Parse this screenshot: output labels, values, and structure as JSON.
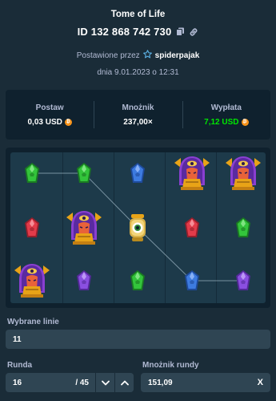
{
  "header": {
    "title": "Tome of Life",
    "bet_id": "ID 132 868 742 730",
    "placed_by_label": "Postawione przez",
    "username": "spiderpajak",
    "date": "dnia 9.01.2023 o 12:31"
  },
  "stats": {
    "bet_label": "Postaw",
    "bet_value": "0,03 USD",
    "multiplier_label": "Mnożnik",
    "multiplier_value": "237,00×",
    "payout_label": "Wypłata",
    "payout_value": "7,12 USD",
    "payout_color": "#00e701",
    "currency_icon": "bitcoin-coin-icon"
  },
  "board": {
    "columns": 5,
    "rows": 3,
    "grid": [
      [
        "green-gem",
        "green-gem",
        "blue-gem",
        "pharaoh",
        "pharaoh"
      ],
      [
        "red-gem",
        "pharaoh",
        "eye-lantern",
        "red-gem",
        "green-gem"
      ],
      [
        "pharaoh",
        "purple-gem",
        "green-gem",
        "blue-gem",
        "purple-gem"
      ]
    ],
    "winning_line_rows": [
      0,
      0,
      1,
      2,
      2
    ]
  },
  "lines": {
    "label": "Wybrane linie",
    "value": "11"
  },
  "round": {
    "label": "Runda",
    "value": "16",
    "total": "/ 45"
  },
  "round_multiplier": {
    "label": "Mnożnik rundy",
    "value": "151,09",
    "suffix": "X"
  }
}
